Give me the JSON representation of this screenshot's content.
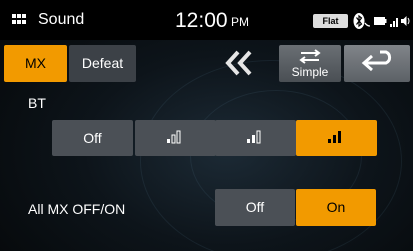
{
  "status_bar": {
    "title": "Sound",
    "time": "12:00",
    "ampm": "PM",
    "eq_badge": "Flat"
  },
  "toolbar": {
    "mx_label": "MX",
    "defeat_label": "Defeat",
    "simple_label": "Simple",
    "selected_tab": "MX"
  },
  "bt": {
    "label": "BT",
    "options": [
      {
        "label": "Off",
        "icon": "none",
        "selected": false
      },
      {
        "label": "",
        "icon": "level-1-icon",
        "selected": false
      },
      {
        "label": "",
        "icon": "level-2-icon",
        "selected": false
      },
      {
        "label": "",
        "icon": "level-3-icon",
        "selected": true
      }
    ]
  },
  "all_mx": {
    "label": "All MX OFF/ON",
    "off_label": "Off",
    "on_label": "On",
    "selected": "On"
  },
  "colors": {
    "accent": "#f29a00",
    "button_off": "#4b5056"
  }
}
